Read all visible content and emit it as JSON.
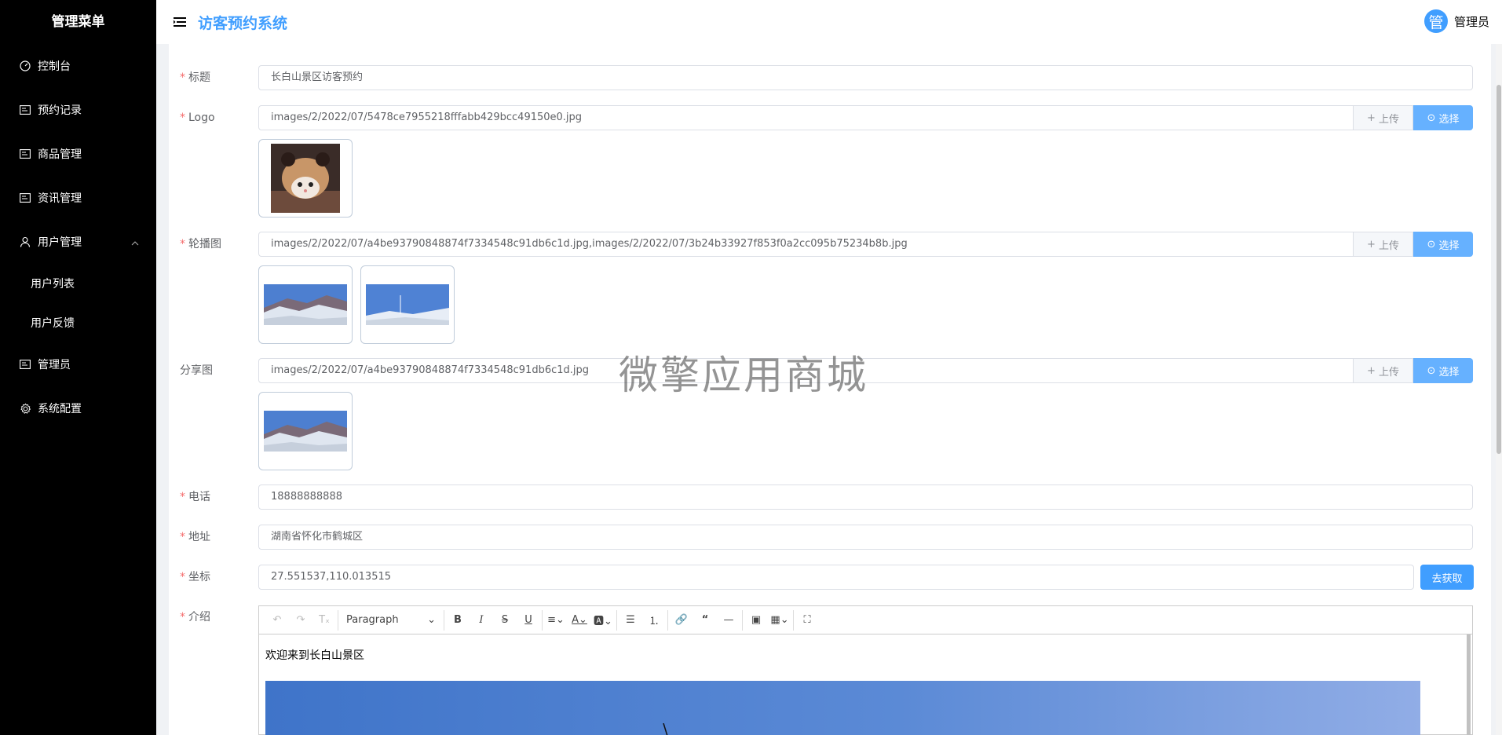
{
  "sidebar": {
    "title": "管理菜单",
    "items": [
      {
        "label": "控制台",
        "icon": "dashboard-icon"
      },
      {
        "label": "预约记录",
        "icon": "doc-icon"
      },
      {
        "label": "商品管理",
        "icon": "doc-icon"
      },
      {
        "label": "资讯管理",
        "icon": "doc-icon"
      },
      {
        "label": "用户管理",
        "icon": "user-icon",
        "expanded": true,
        "children": [
          "用户列表",
          "用户反馈"
        ]
      },
      {
        "label": "管理员",
        "icon": "doc-icon"
      },
      {
        "label": "系统配置",
        "icon": "gear-icon"
      }
    ]
  },
  "header": {
    "title": "访客预约系统",
    "avatar_text": "管",
    "user_name": "管理员"
  },
  "form": {
    "title_label": "标题",
    "title_value": "长白山景区访客预约",
    "logo_label": "Logo",
    "logo_value": "images/2/2022/07/5478ce7955218fffabb429bcc49150e0.jpg",
    "banner_label": "轮播图",
    "banner_value": "images/2/2022/07/a4be93790848874f7334548c91db6c1d.jpg,images/2/2022/07/3b24b33927f853f0a2cc095b75234b8b.jpg",
    "share_label": "分享图",
    "share_value": "images/2/2022/07/a4be93790848874f7334548c91db6c1d.jpg",
    "phone_label": "电话",
    "phone_value": "18888888888",
    "address_label": "地址",
    "address_value": "湖南省怀化市鹤城区",
    "coords_label": "坐标",
    "coords_value": "27.551537,110.013515",
    "coords_button": "去获取",
    "intro_label": "介绍",
    "upload_label": "上传",
    "select_label": "选择"
  },
  "editor": {
    "block_format": "Paragraph",
    "content_text": "欢迎来到长白山景区"
  },
  "watermark": "微擎应用商城",
  "colors": {
    "accent": "#409eff",
    "sidebar_bg": "#000000",
    "required": "#f56c6c"
  }
}
